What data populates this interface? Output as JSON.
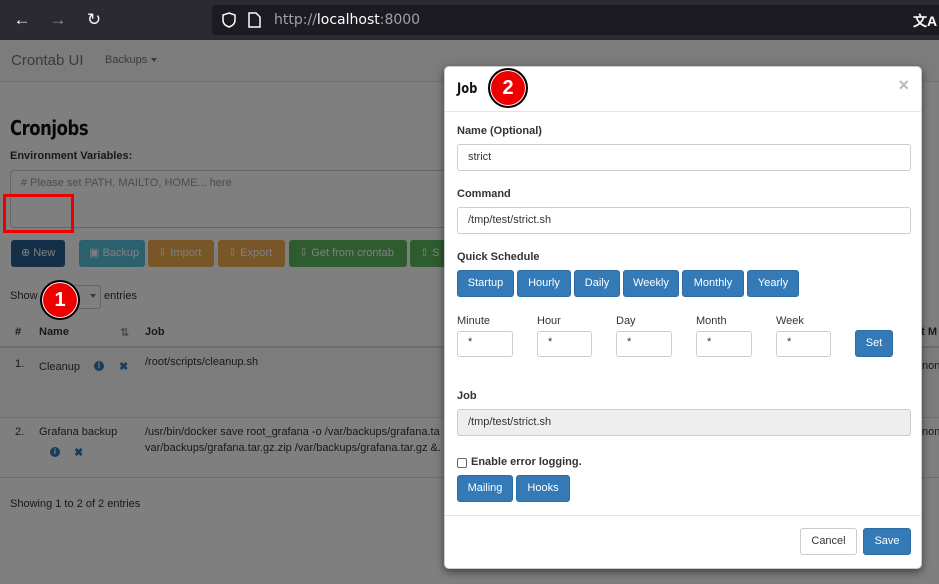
{
  "browser": {
    "url_prefix": "http://",
    "url_host": "localhost",
    "url_port": ":8000",
    "back_icon": "←",
    "forward_icon": "→",
    "reload_icon": "↻",
    "translate_icon": "文A"
  },
  "navbar": {
    "brand": "Crontab UI",
    "backups_label": "Backups"
  },
  "main": {
    "heading": "Cronjobs",
    "env_label": "Environment Variables:",
    "env_placeholder": "# Please set PATH, MAILTO, HOME... here",
    "toolbar": {
      "new": "New",
      "backup": "Backup",
      "import": "Import",
      "export": "Export",
      "get_from_crontab": "Get from crontab",
      "save_to_crontab_partial": "S"
    },
    "show_label": "Show",
    "entries_label": "entries",
    "table": {
      "headers": {
        "num": "#",
        "name": "Name",
        "job": "Job",
        "last_partial": "st M"
      },
      "rows": [
        {
          "num": "1.",
          "name": "Cleanup",
          "job": "/root/scripts/cleanup.sh",
          "extra": "non"
        },
        {
          "num": "2.",
          "name": "Grafana backup",
          "job_line1": "/usr/bin/docker save root_grafana -o /var/backups/grafana.ta",
          "job_line2": "var/backups/grafana.tar.gz.zip /var/backups/grafana.tar.gz &.",
          "extra": "non"
        }
      ]
    },
    "footer_info": "Showing 1 to 2 of 2 entries"
  },
  "annotations": {
    "one": "1",
    "two": "2"
  },
  "modal": {
    "title": "Job",
    "close": "×",
    "name_label": "Name (Optional)",
    "name_value": "strict",
    "command_label": "Command",
    "command_value": "/tmp/test/strict.sh",
    "quick_schedule_label": "Quick Schedule",
    "quick_buttons": [
      "Startup",
      "Hourly",
      "Daily",
      "Weekly",
      "Monthly",
      "Yearly"
    ],
    "fields": [
      {
        "label": "Minute",
        "value": "*"
      },
      {
        "label": "Hour",
        "value": "*"
      },
      {
        "label": "Day",
        "value": "*"
      },
      {
        "label": "Month",
        "value": "*"
      },
      {
        "label": "Week",
        "value": "*"
      }
    ],
    "set_label": "Set",
    "job_label": "Job",
    "job_value": "/tmp/test/strict.sh",
    "error_logging_label": "Enable error logging.",
    "mailing_label": "Mailing",
    "hooks_label": "Hooks",
    "cancel_label": "Cancel",
    "save_label": "Save"
  },
  "colors": {
    "primary": "#337ab7",
    "info": "#5bc0de",
    "warning": "#f0ad4e",
    "success": "#5cb85c",
    "annotation": "#ee0000"
  }
}
